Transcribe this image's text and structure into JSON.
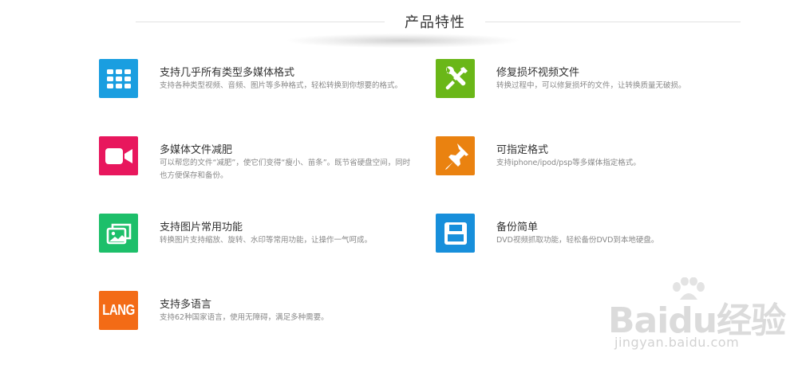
{
  "section": {
    "title": "产品特性"
  },
  "features": [
    {
      "name": "支持几乎所有类型多媒体格式",
      "desc": "支持各种类型视频、音频、图片等多种格式，轻松转换到你想要的格式。",
      "icon": "grid-icon",
      "color": "#1a9ee0"
    },
    {
      "name": "修复损坏视频文件",
      "desc": "转换过程中，可以修复损坏的文件，让转换质量无破损。",
      "icon": "tools-icon",
      "color": "#6ab718"
    },
    {
      "name": "多媒体文件减肥",
      "desc": "可以帮您的文件“减肥”，使它们变得“瘦小、苗条”。既节省硬盘空间，同时也方便保存和备份。",
      "icon": "video-camera-icon",
      "color": "#e8175d"
    },
    {
      "name": "可指定格式",
      "desc": "支持iphone/ipod/psp等多媒体指定格式。",
      "icon": "pushpin-icon",
      "color": "#ea8210"
    },
    {
      "name": "支持图片常用功能",
      "desc": "转换图片支持缩放、旋转、水印等常用功能，让操作一气呵成。",
      "icon": "images-icon",
      "color": "#1dbf6a"
    },
    {
      "name": "备份简单",
      "desc": "DVD视频抓取功能，轻松备份DVD到本地硬盘。",
      "icon": "floppy-disk-icon",
      "color": "#178fdb"
    },
    {
      "name": "支持多语言",
      "desc": "支持62种国家语言，使用无障碍，满足多种需要。",
      "icon": "lang-icon",
      "icon_text": "LANG",
      "color": "#f36b16"
    }
  ],
  "watermark": {
    "logo": "Baidu经验",
    "url": "jingyan.baidu.com"
  }
}
